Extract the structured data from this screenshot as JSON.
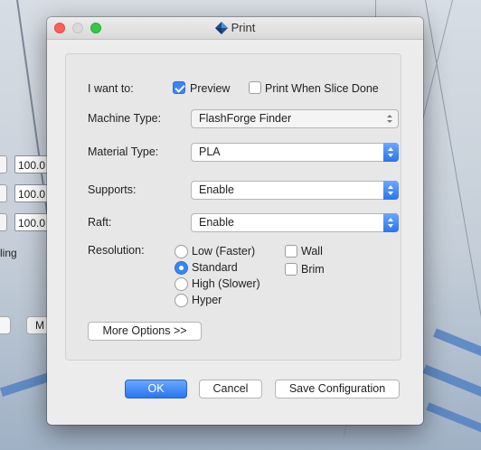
{
  "window": {
    "title": "Print"
  },
  "form": {
    "want_label": "I want to:",
    "preview_label": "Preview",
    "preview_checked": true,
    "print_when_done_label": "Print When Slice Done",
    "print_when_done_checked": false,
    "machine_type_label": "Machine Type:",
    "machine_type_value": "FlashForge Finder",
    "material_type_label": "Material Type:",
    "material_type_value": "PLA",
    "supports_label": "Supports:",
    "supports_value": "Enable",
    "raft_label": "Raft:",
    "raft_value": "Enable",
    "resolution_label": "Resolution:",
    "resolution_options": [
      "Low (Faster)",
      "Standard",
      "High (Slower)",
      "Hyper"
    ],
    "resolution_selected": "Standard",
    "wall_label": "Wall",
    "wall_checked": false,
    "brim_label": "Brim",
    "brim_checked": false,
    "more_options_label": "More Options >>"
  },
  "buttons": {
    "ok": "OK",
    "cancel": "Cancel",
    "save": "Save Configuration"
  },
  "background": {
    "field_values": [
      "100.0",
      "100.0",
      "100.0"
    ],
    "scaling_label": "ling",
    "partial_button_label": "M"
  },
  "colors": {
    "accent": "#3a84f5",
    "close": "#fc605c",
    "maximize": "#34c84a"
  }
}
